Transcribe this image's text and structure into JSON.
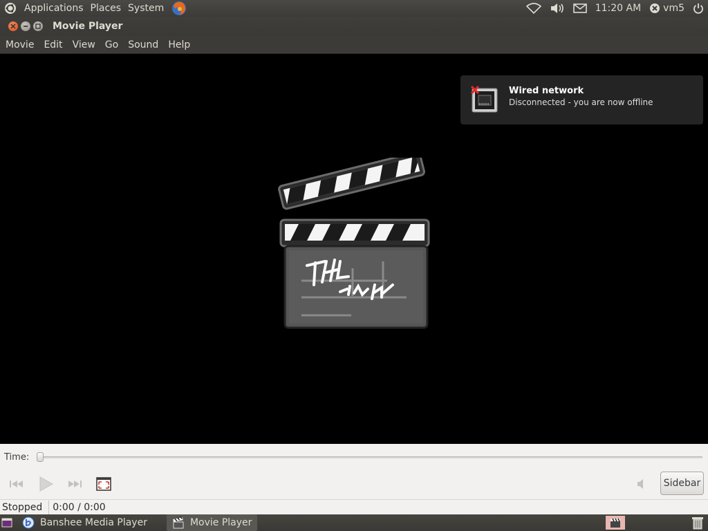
{
  "top_panel": {
    "menus": [
      "Applications",
      "Places",
      "System"
    ],
    "clock": "11:20 AM",
    "user": "vm5",
    "icons": [
      "ubuntu-logo-icon",
      "firefox-icon",
      "wifi-icon",
      "volume-icon",
      "mail-icon",
      "user-status-icon",
      "power-icon"
    ]
  },
  "window": {
    "title": "Movie Player",
    "menubar": [
      "Movie",
      "Edit",
      "View",
      "Go",
      "Sound",
      "Help"
    ]
  },
  "notification": {
    "title": "Wired network",
    "body": "Disconnected - you are now offline"
  },
  "controls": {
    "time_label": "Time:",
    "seek_fraction": 0,
    "sidebar_label": "Sidebar",
    "status_state": "Stopped",
    "status_time": "0:00 / 0:00"
  },
  "bottom_panel": {
    "tasks": [
      {
        "label": "Banshee Media Player",
        "active": false
      },
      {
        "label": "Movie Player",
        "active": true
      }
    ]
  },
  "colors": {
    "panel_bg": "#3c3b37",
    "close_button": "#df4a16",
    "controls_bg": "#f2f1f0"
  }
}
